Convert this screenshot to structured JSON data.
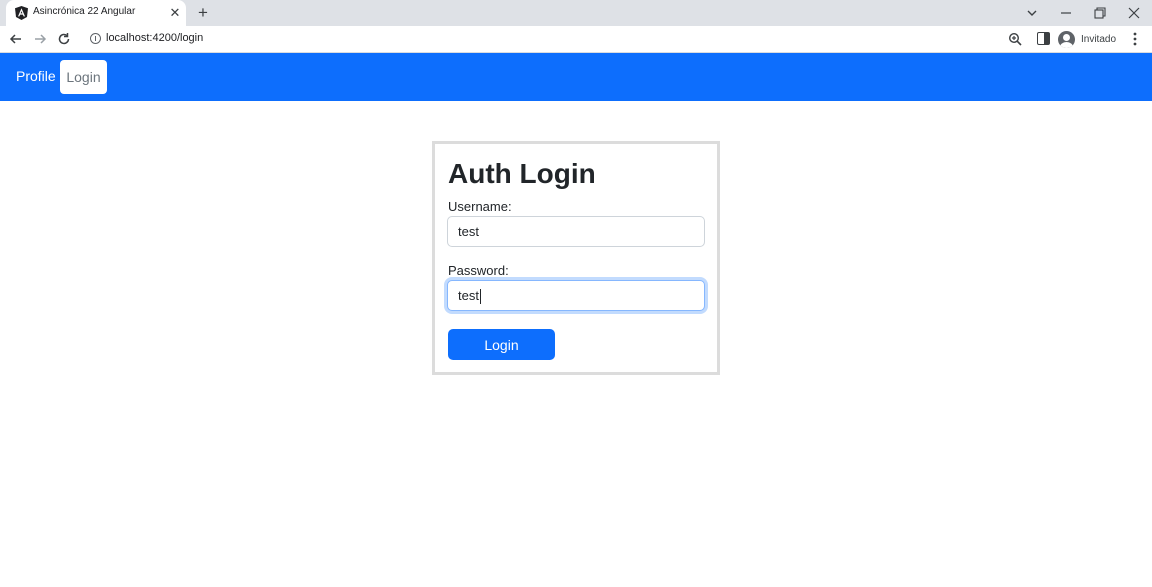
{
  "browser": {
    "tab_title": "Asincrónica 22 Angular",
    "tab_close": "✕",
    "new_tab": "+",
    "url": "localhost:4200/login",
    "profile_name": "Invitado",
    "icons": {
      "favicon": "angular-icon",
      "back": "arrow-left-icon",
      "forward": "arrow-right-icon",
      "reload": "reload-icon",
      "site_info": "info-icon",
      "zoom": "zoom-icon",
      "side_panel": "side-panel-icon",
      "avatar": "avatar-icon",
      "menu": "kebab-menu-icon"
    }
  },
  "navbar": {
    "color": "#0d6efd",
    "items": [
      {
        "label": "Profile",
        "active": false
      },
      {
        "label": "Login",
        "active": true
      }
    ]
  },
  "login": {
    "title": "Auth Login",
    "username_label": "Username:",
    "username_value": "test",
    "password_label": "Password:",
    "password_value": "test",
    "submit_label": "Login",
    "button_color": "#0d6efd"
  }
}
